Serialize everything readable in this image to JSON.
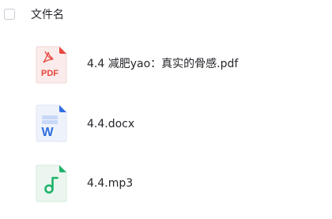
{
  "header": {
    "column_title": "文件名"
  },
  "files": [
    {
      "name": "4.4 减肥yao：真实的骨感.pdf",
      "icon": "pdf-file-icon",
      "icon_label": "PDF",
      "accent": "#e8453c"
    },
    {
      "name": "4.4.docx",
      "icon": "word-file-icon",
      "icon_label": "W",
      "accent": "#2f6fe0"
    },
    {
      "name": "4.4.mp3",
      "icon": "audio-file-icon",
      "icon_label": "",
      "accent": "#1fb36a"
    }
  ]
}
